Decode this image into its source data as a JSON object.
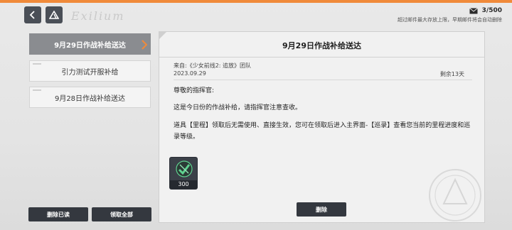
{
  "mailbox": {
    "count": "3/500",
    "note": "超过邮件最大存放上限，早期邮件将会自动删除"
  },
  "mail_list": [
    {
      "label": "9月29日作战补给送达",
      "selected": true
    },
    {
      "label": "引力测试开服补给",
      "selected": false
    },
    {
      "label": "9月28日作战补给送达",
      "selected": false
    }
  ],
  "mail": {
    "title": "9月29日作战补给送达",
    "sender": "来自:《少女前线2: 追放》团队",
    "date": "2023.09.29",
    "remaining": "剩余13天",
    "greeting": "尊敬的指挥官:",
    "body1": "这是今日份的作战补给，请指挥官注意查收。",
    "body2": "道具【里程】领取后无需使用、直接生效，您可在领取后进入主界面-【巡录】查看您当前的里程进度和巡录等级。",
    "reward": {
      "count": "300",
      "icon": "mileage-icon"
    }
  },
  "buttons": {
    "delete_read": "删除已读",
    "claim_all": "领取全部",
    "delete": "删除"
  },
  "colors": {
    "accent": "#f08a3a",
    "selected_item": "#8a8c90",
    "dark_button": "#34383f"
  }
}
